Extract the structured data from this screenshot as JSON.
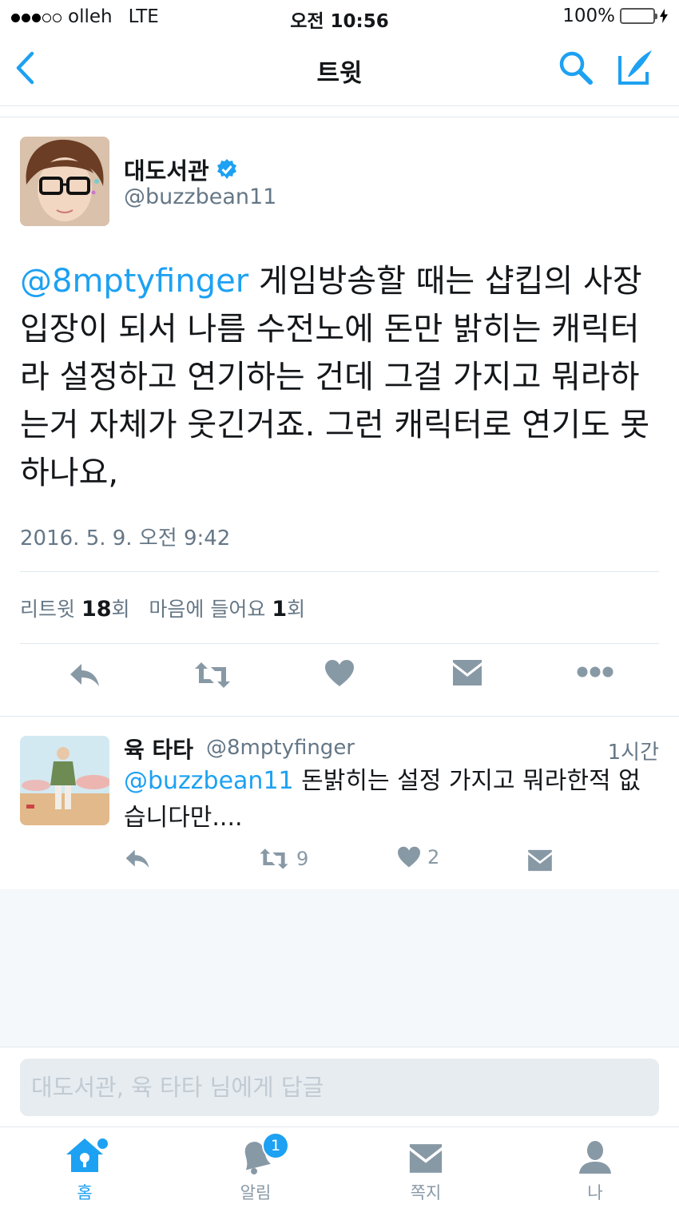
{
  "status_bar": {
    "carrier": "olleh",
    "network": "LTE",
    "time": "오전 10:56",
    "battery": "100%"
  },
  "nav": {
    "title": "트윗"
  },
  "tweet": {
    "name": "대도서관",
    "handle": "@buzzbean11",
    "mention": "@8mptyfinger",
    "text": " 게임방송할 때는 샵킵의 사장 입장이 되서 나름 수전노에 돈만 밝히는 캐릭터라 설정하고 연기하는 건데 그걸 가지고 뭐라하는거 자체가 웃긴거죠. 그런 캐릭터로 연기도 못하나요,",
    "timestamp": "2016. 5. 9. 오전 9:42",
    "retweet_label": "리트윗",
    "retweet_count": "18",
    "retweet_unit": "회",
    "like_label": "마음에 들어요",
    "like_count": "1",
    "like_unit": "회"
  },
  "reply": {
    "name": "육 타타",
    "handle": "@8mptyfinger",
    "time": "1시간",
    "mention": "@buzzbean11",
    "text": " 돈밝히는 설정 가지고 뭐라한적 없습니다만....",
    "retweet_count": "9",
    "like_count": "2"
  },
  "composer": {
    "placeholder": "대도서관, 육 타타 님에게 답글"
  },
  "tabs": [
    {
      "label": "홈"
    },
    {
      "label": "알림",
      "badge": "1"
    },
    {
      "label": "쪽지"
    },
    {
      "label": "나"
    }
  ],
  "colors": {
    "accent": "#1da1f2",
    "muted": "#657786",
    "icon_gray": "#8899a6",
    "battery": "#4cd964"
  }
}
